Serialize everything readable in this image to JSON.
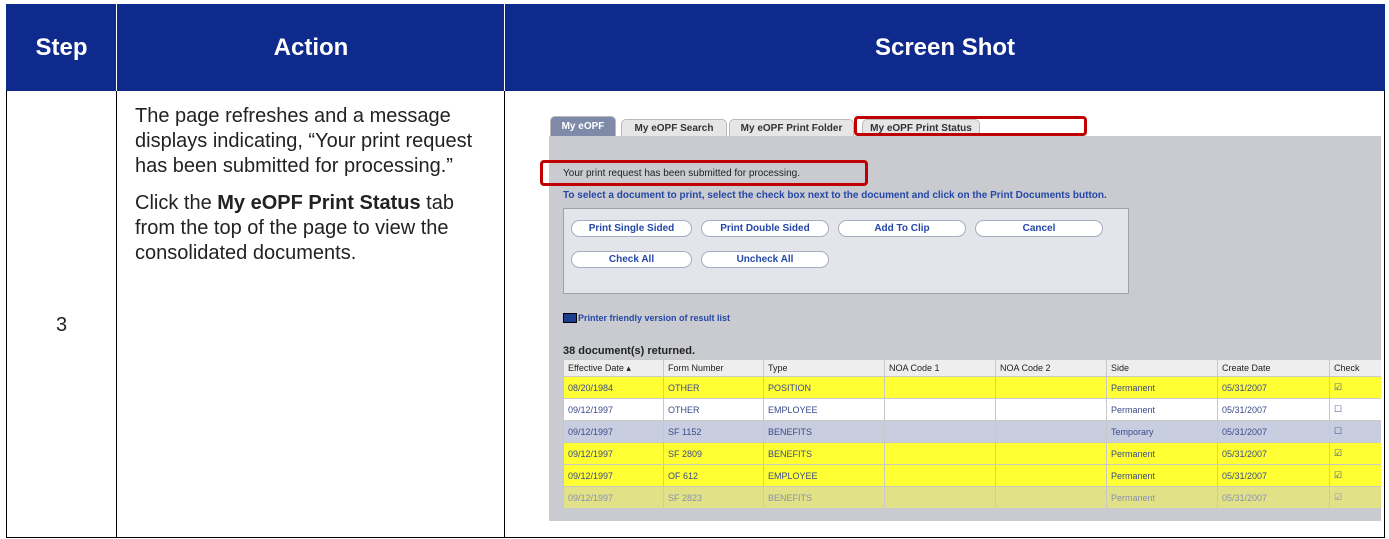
{
  "header": {
    "step": "Step",
    "action": "Action",
    "screenshot": "Screen Shot"
  },
  "row": {
    "step_number": "3",
    "action_p1": "The page refreshes and a message displays indicating, “Your print request has been submitted for processing.”",
    "action_p2_pre": "Click the ",
    "action_p2_bold": "My eOPF Print Status",
    "action_p2_post": " tab from the top of the page to view the consolidated documents."
  },
  "screenshot": {
    "tabs": [
      "My eOPF",
      "My eOPF Search",
      "My eOPF Print Folder",
      "My eOPF Print Status"
    ],
    "message": "Your print request has been submitted for processing.",
    "instruction": "To select a document to print, select the check box next to the document and click on the Print Documents button.",
    "buttons": {
      "print_single": "Print Single Sided",
      "print_double": "Print Double Sided",
      "add_to_clip": "Add To Clip",
      "cancel": "Cancel",
      "check_all": "Check All",
      "uncheck_all": "Uncheck All"
    },
    "printer_friendly": "Printer friendly version of result list",
    "count": "38 document(s) returned.",
    "columns": [
      "Effective Date ▴",
      "Form Number",
      "Type",
      "NOA Code 1",
      "NOA Code 2",
      "Side",
      "Create Date",
      "Check"
    ],
    "rows": [
      {
        "date": "08/20/1984",
        "form": "OTHER",
        "type": "POSITION",
        "noa1": "",
        "noa2": "",
        "side": "Permanent",
        "created": "05/31/2007",
        "check": "☑"
      },
      {
        "date": "09/12/1997",
        "form": "OTHER",
        "type": "EMPLOYEE",
        "noa1": "",
        "noa2": "",
        "side": "Permanent",
        "created": "05/31/2007",
        "check": "☐"
      },
      {
        "date": "09/12/1997",
        "form": "SF 1152",
        "type": "BENEFITS",
        "noa1": "",
        "noa2": "",
        "side": "Temporary",
        "created": "05/31/2007",
        "check": "☐"
      },
      {
        "date": "09/12/1997",
        "form": "SF 2809",
        "type": "BENEFITS",
        "noa1": "",
        "noa2": "",
        "side": "Permanent",
        "created": "05/31/2007",
        "check": "☑"
      },
      {
        "date": "09/12/1997",
        "form": "OF 612",
        "type": "EMPLOYEE",
        "noa1": "",
        "noa2": "",
        "side": "Permanent",
        "created": "05/31/2007",
        "check": "☑"
      },
      {
        "date": "09/12/1997",
        "form": "SF 2823",
        "type": "BENEFITS",
        "noa1": "",
        "noa2": "",
        "side": "Permanent",
        "created": "05/31/2007",
        "check": "☑"
      }
    ]
  }
}
